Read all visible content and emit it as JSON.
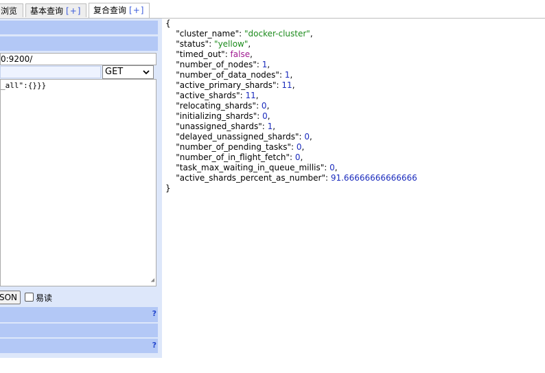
{
  "tabs": [
    {
      "label": "浏览",
      "plus": ""
    },
    {
      "label": "基本查询",
      "plus": "[+]"
    },
    {
      "label": "复合查询",
      "plus": "[+]"
    }
  ],
  "request": {
    "url": "0:9200/",
    "method": "GET",
    "body": "_all\":{}}}",
    "json_button": "SON",
    "readable_label": "易读",
    "readable_checked": false,
    "help_glyph": "?"
  },
  "response": {
    "open": "{",
    "close": "}",
    "fields": [
      {
        "key": "\"cluster_name\"",
        "value": "\"docker-cluster\"",
        "type": "s"
      },
      {
        "key": "\"status\"",
        "value": "\"yellow\"",
        "type": "s"
      },
      {
        "key": "\"timed_out\"",
        "value": "false",
        "type": "b"
      },
      {
        "key": "\"number_of_nodes\"",
        "value": "1",
        "type": "n"
      },
      {
        "key": "\"number_of_data_nodes\"",
        "value": "1",
        "type": "n"
      },
      {
        "key": "\"active_primary_shards\"",
        "value": "11",
        "type": "n"
      },
      {
        "key": "\"active_shards\"",
        "value": "11",
        "type": "n"
      },
      {
        "key": "\"relocating_shards\"",
        "value": "0",
        "type": "n"
      },
      {
        "key": "\"initializing_shards\"",
        "value": "0",
        "type": "n"
      },
      {
        "key": "\"unassigned_shards\"",
        "value": "1",
        "type": "n"
      },
      {
        "key": "\"delayed_unassigned_shards\"",
        "value": "0",
        "type": "n"
      },
      {
        "key": "\"number_of_pending_tasks\"",
        "value": "0",
        "type": "n"
      },
      {
        "key": "\"number_of_in_flight_fetch\"",
        "value": "0",
        "type": "n"
      },
      {
        "key": "\"task_max_waiting_in_queue_millis\"",
        "value": "0",
        "type": "n"
      },
      {
        "key": "\"active_shards_percent_as_number\"",
        "value": "91.66666666666666",
        "type": "n"
      }
    ]
  }
}
